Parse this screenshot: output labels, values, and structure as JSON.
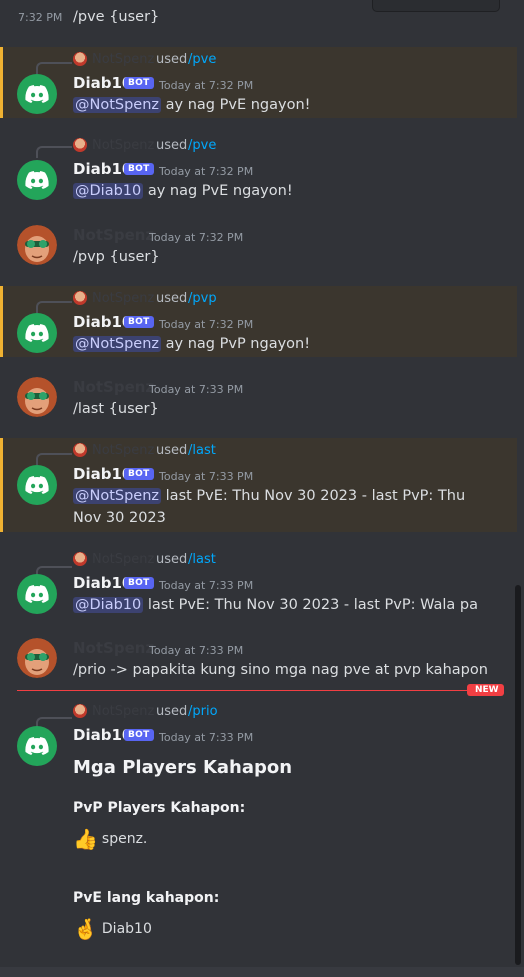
{
  "top_message": {
    "time": "7:32 PM",
    "text": "/pve {user}"
  },
  "bot": {
    "name": "Diab10",
    "badge": "BOT"
  },
  "reply_used": "used",
  "messages": [
    {
      "reply_name": "NotSpenz",
      "reply_cmd": "/pve",
      "time": "Today at 7:32 PM",
      "mention": "@NotSpenz",
      "text": " ay nag PvE ngayon!"
    },
    {
      "reply_name": "NotSpenz",
      "reply_cmd": "/pve",
      "time": "Today at 7:32 PM",
      "mention": "@Diab10",
      "text": " ay nag PvE ngayon!"
    },
    {
      "user_name": "NotSpenz",
      "time": "Today at 7:32 PM",
      "text": "/pvp {user}"
    },
    {
      "reply_name": "NotSpenz",
      "reply_cmd": "/pvp",
      "time": "Today at 7:32 PM",
      "mention": "@NotSpenz",
      "text": " ay nag PvP ngayon!"
    },
    {
      "user_name": "NotSpenz",
      "time": "Today at 7:33 PM",
      "text": "/last {user}"
    },
    {
      "reply_name": "NotSpenz",
      "reply_cmd": "/last",
      "time": "Today at 7:33 PM",
      "mention": "@NotSpenz",
      "text": " last PvE: Thu Nov 30 2023 - last PvP: Thu",
      "text2": "Nov 30 2023"
    },
    {
      "reply_name": "NotSpenz",
      "reply_cmd": "/last",
      "time": "Today at 7:33 PM",
      "mention": "@Diab10",
      "text": " last PvE: Thu Nov 30 2023 - last PvP: Wala pa"
    },
    {
      "user_name": "NotSpenz",
      "time": "Today at 7:33 PM",
      "text": "/prio -> papakita kung sino mga nag pve at pvp kahapon"
    },
    {
      "reply_name": "NotSpenz",
      "reply_cmd": "/prio",
      "time": "Today at 7:33 PM"
    }
  ],
  "new_label": "NEW",
  "embed": {
    "title": "Mga Players Kahapon",
    "pvp_label": "PvP Players Kahapon:",
    "pvp_emoji": "👍",
    "pvp_value": "spenz.",
    "pve_label": "PvE lang kahapon:",
    "pve_emoji": "🤞",
    "pve_value": "Diab10"
  },
  "colors": {
    "accent": "#5865f2",
    "link": "#00a8fc",
    "highlight_border": "#f0b232",
    "new": "#f23f43",
    "bot_avatar": "#23a55a"
  }
}
